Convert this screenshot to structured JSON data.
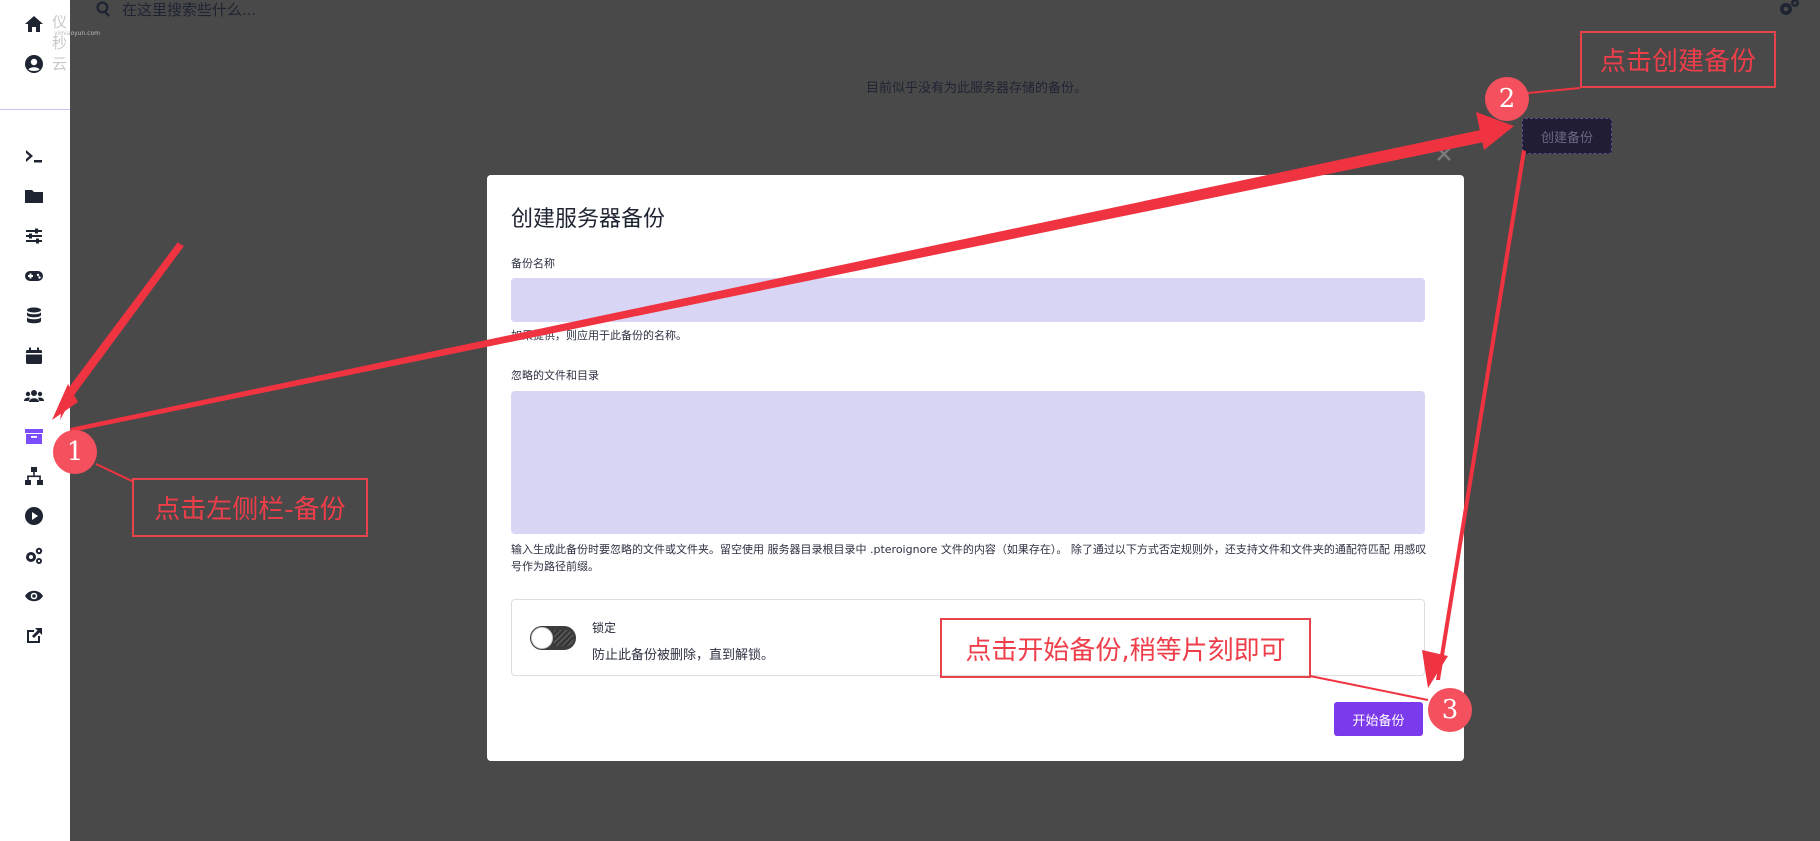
{
  "sidebar": {
    "logo_text": "仪秒云",
    "logo_subtext": "yimiaoyun.com",
    "items": [
      {
        "name": "home-icon",
        "active": false
      },
      {
        "name": "account-icon",
        "active": false
      },
      {
        "name": "terminal-icon",
        "active": false
      },
      {
        "name": "folder-icon",
        "active": false
      },
      {
        "name": "sliders-icon",
        "active": false
      },
      {
        "name": "gamepad-icon",
        "active": false
      },
      {
        "name": "database-icon",
        "active": false
      },
      {
        "name": "calendar-icon",
        "active": false
      },
      {
        "name": "users-icon",
        "active": false
      },
      {
        "name": "archive-icon",
        "active": true
      },
      {
        "name": "network-icon",
        "active": false
      },
      {
        "name": "play-icon",
        "active": false
      },
      {
        "name": "cogs-icon",
        "active": false
      },
      {
        "name": "eye-icon",
        "active": false
      },
      {
        "name": "external-link-icon",
        "active": false
      }
    ]
  },
  "search": {
    "placeholder": "在这里搜索些什么..."
  },
  "page": {
    "empty_message": "目前似乎没有为此服务器存储的备份。",
    "create_button": "创建备份"
  },
  "modal": {
    "title": "创建服务器备份",
    "name_label": "备份名称",
    "name_value": "",
    "name_help": "如果提供，则应用于此备份的名称。",
    "ignored_label": "忽略的文件和目录",
    "ignored_value": "",
    "ignored_help": "输入生成此备份时要忽略的文件或文件夹。留空使用 服务器目录根目录中 .pteroignore 文件的内容（如果存在）。 除了通过以下方式否定规则外，还支持文件和文件夹的通配符匹配 用感叹号作为路径前缀。",
    "lock_title": "锁定",
    "lock_desc": "防止此备份被删除，直到解锁。",
    "lock_enabled": false,
    "start_button": "开始备份"
  },
  "annotations": {
    "callout1": "点击左侧栏-备份",
    "callout2": "点击创建备份",
    "callout3": "点击开始备份,稍等片刻即可",
    "badge1": "1",
    "badge2": "2",
    "badge3": "3",
    "color": "#ef3340"
  },
  "colors": {
    "accent": "#7c3aed",
    "backdrop": "#494949",
    "field": "#d9d6f5"
  }
}
